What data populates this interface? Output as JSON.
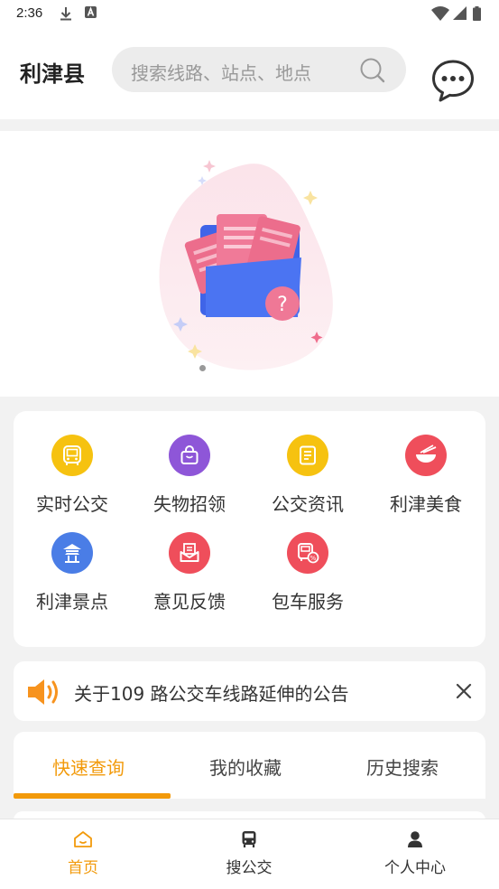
{
  "status_bar": {
    "time": "2:36"
  },
  "header": {
    "city": "利津县",
    "search_placeholder": "搜索线路、站点、地点"
  },
  "grid": {
    "items": [
      {
        "label": "实时公交",
        "icon": "bus-icon",
        "color": "#f6c210"
      },
      {
        "label": "失物招领",
        "icon": "bag-icon",
        "color": "#8e56d8"
      },
      {
        "label": "公交资讯",
        "icon": "news-icon",
        "color": "#f6c210"
      },
      {
        "label": "利津美食",
        "icon": "food-bowl-icon",
        "color": "#ef4e5b"
      },
      {
        "label": "利津景点",
        "icon": "pagoda-icon",
        "color": "#4a7de6"
      },
      {
        "label": "意见反馈",
        "icon": "feedback-mail-icon",
        "color": "#ef4e5b"
      },
      {
        "label": "包车服务",
        "icon": "charter-bus-icon",
        "color": "#ef4e5b"
      }
    ]
  },
  "notice": {
    "text": "关于109 路公交车线路延伸的公告"
  },
  "tabs": {
    "items": [
      {
        "label": "快速查询"
      },
      {
        "label": "我的收藏"
      },
      {
        "label": "历史搜索"
      }
    ],
    "active_index": 0
  },
  "bottom_nav": {
    "items": [
      {
        "label": "首页"
      },
      {
        "label": "搜公交"
      },
      {
        "label": "个人中心"
      }
    ],
    "active_index": 0
  },
  "colors": {
    "accent": "#f29a0b"
  }
}
